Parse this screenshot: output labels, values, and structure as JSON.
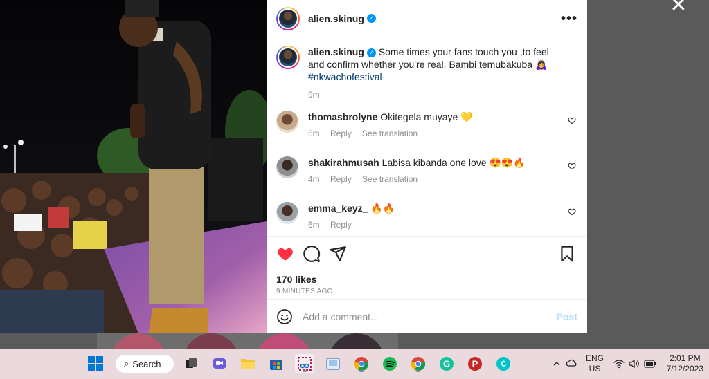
{
  "post": {
    "author": "alien.skinug",
    "caption": "Some times your fans touch you ,to feel and confirm whether you're real. Bambi temubakuba 🙇‍♀️",
    "hashtag": "#nkwachofestival",
    "caption_time": "9m",
    "likes": "170 likes",
    "posted_ago": "9 MINUTES AGO"
  },
  "comments": [
    {
      "user": "thomasbrolyne",
      "text": "Okitegela muyaye 💛",
      "time": "6m",
      "reply": "Reply",
      "translate": "See translation"
    },
    {
      "user": "shakirahmusah",
      "text": "Labisa kibanda one love 😍😍🔥",
      "time": "4m",
      "reply": "Reply",
      "translate": "See translation"
    },
    {
      "user": "emma_keyz_",
      "text": "🔥🔥",
      "time": "6m",
      "reply": "Reply"
    }
  ],
  "comment_box": {
    "placeholder": "Add a comment...",
    "post_label": "Post"
  },
  "taskbar": {
    "search_label": "Search",
    "lang_top": "ENG",
    "lang_bottom": "US",
    "time": "2:01 PM",
    "date": "7/12/2023"
  },
  "colors": {
    "like_red": "#ff3040",
    "verified_blue": "#0095f6",
    "post_disabled": "#b2dffc",
    "taskbar_bg": "#eadadd"
  }
}
